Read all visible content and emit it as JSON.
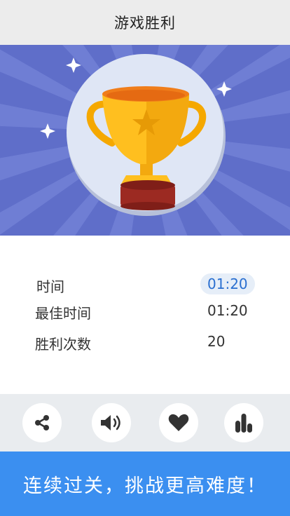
{
  "header": {
    "title": "游戏胜利"
  },
  "hero": {
    "background": "#5f6ec9",
    "ray_color": "#6f7ed4",
    "circle_color": "#dfe6f5",
    "trophy_gold": "#ffbf1f",
    "trophy_base": "#9c2a22"
  },
  "stats": [
    {
      "label": "时间",
      "value": "01:20"
    },
    {
      "label": "最佳时间",
      "value": "01:20"
    },
    {
      "label": "胜利次数",
      "value": "20"
    }
  ],
  "toolbar": {
    "buttons": [
      {
        "name": "share-button",
        "icon": "share-icon"
      },
      {
        "name": "sound-button",
        "icon": "speaker-icon"
      },
      {
        "name": "favorite-button",
        "icon": "heart-icon"
      },
      {
        "name": "leaderboard-button",
        "icon": "bar-chart-icon"
      }
    ]
  },
  "cta": {
    "label": "连续过关，挑战更高难度！",
    "color": "#3b8ff0"
  }
}
